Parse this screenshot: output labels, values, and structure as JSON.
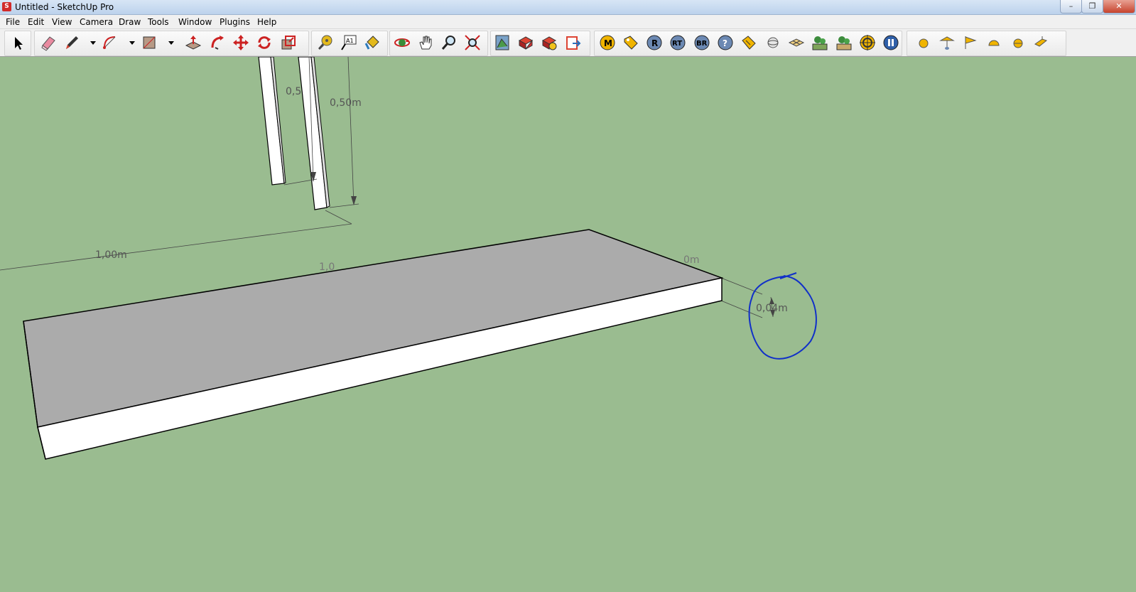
{
  "window": {
    "title": "Untitled - SketchUp Pro",
    "app_icon": "sketchup-logo-icon",
    "controls": {
      "minimize": "–",
      "maximize": "❐",
      "close": "✕"
    }
  },
  "menu": [
    "File",
    "Edit",
    "View",
    "Camera",
    "Draw",
    "Tools",
    "Window",
    "Plugins",
    "Help"
  ],
  "toolbar": {
    "tools": [
      "select",
      "eraser",
      "pencil",
      "arc",
      "rectangle",
      "push-pull",
      "follow-me",
      "move",
      "rotate",
      "scale",
      "tape-measure",
      "text",
      "paint-bucket",
      "orbit",
      "pan",
      "zoom",
      "zoom-extents",
      "get-models",
      "share-model",
      "warehouse",
      "send-to-layout"
    ],
    "text_tool_label": "A1",
    "plugin_buttons": [
      "M",
      "tag",
      "R",
      "RT",
      "BR",
      "?",
      "label",
      "sphere",
      "grid",
      "tree-1",
      "tree-2",
      "target",
      "pause"
    ],
    "extra_shapes": [
      "sphere",
      "umbrella",
      "flag",
      "dome",
      "half-sphere",
      "wedge"
    ]
  },
  "viewport": {
    "background": "#9abc90",
    "dimensions": {
      "width": "1,00m",
      "leg_height": "0,50m",
      "leg_height_partial": "0,5",
      "thickness": "0,04m",
      "hidden_1": "1,0",
      "hidden_2": "0m"
    },
    "annotation": "blue-ink-circle"
  }
}
